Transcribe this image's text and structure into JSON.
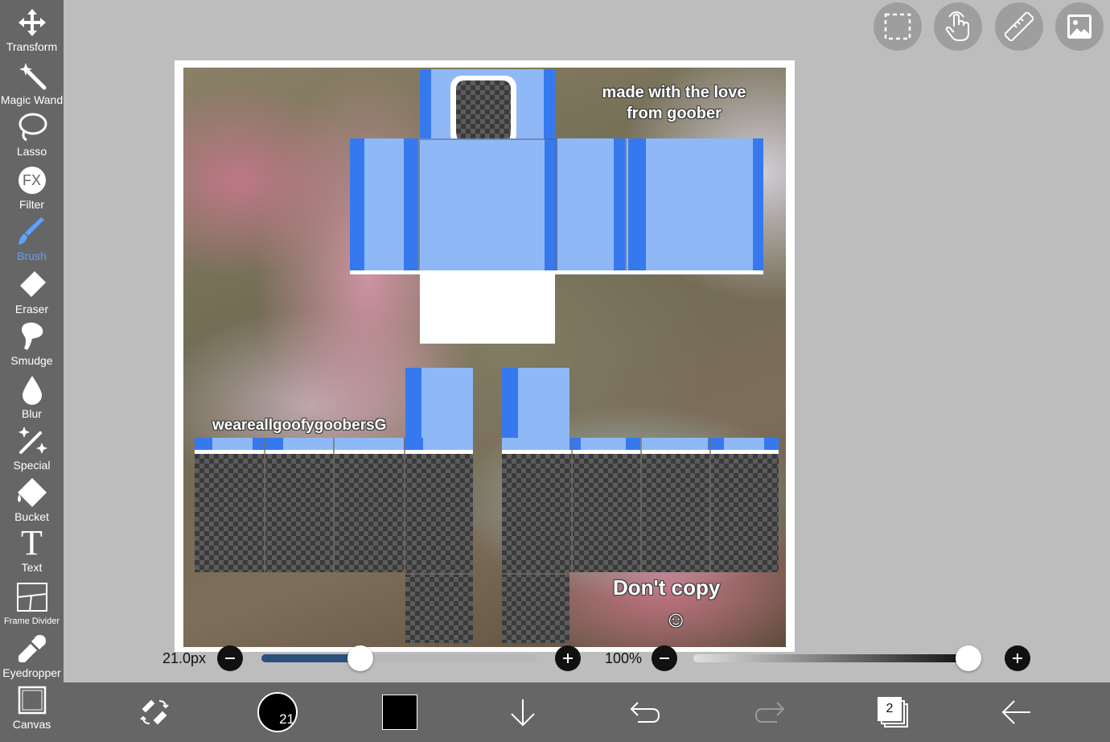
{
  "toolbar": {
    "tools": [
      {
        "label": "Transform"
      },
      {
        "label": "Magic Wand"
      },
      {
        "label": "Lasso"
      },
      {
        "label": "Filter",
        "icon_text": "FX"
      },
      {
        "label": "Brush"
      },
      {
        "label": "Eraser"
      },
      {
        "label": "Smudge"
      },
      {
        "label": "Blur"
      },
      {
        "label": "Special"
      },
      {
        "label": "Bucket"
      },
      {
        "label": "Text",
        "icon_text": "T"
      },
      {
        "label": "Frame Divider"
      },
      {
        "label": "Eyedropper"
      },
      {
        "label": "Canvas"
      }
    ],
    "active_tool": "Brush",
    "active_color": "#5aa3ff"
  },
  "top_buttons": [
    "selection-icon",
    "touch-icon",
    "ruler-icon",
    "image-icon"
  ],
  "artwork": {
    "watermark_top": "made with the love",
    "watermark_top_2": "from goober",
    "watermark_mid": "weareallgoofygoobersG",
    "watermark_bottom": "Don't copy",
    "smiley": "☺",
    "colors": {
      "light_blue": "#8fb8f6",
      "dark_blue": "#3679ef"
    }
  },
  "brush_size": {
    "label": "21.0px",
    "value_fraction": 0.36
  },
  "opacity": {
    "label": "100%",
    "value_fraction": 1.0
  },
  "bottombar": {
    "brush_preview_number": "21",
    "primary_color": "#000000",
    "layer_count": "2"
  }
}
